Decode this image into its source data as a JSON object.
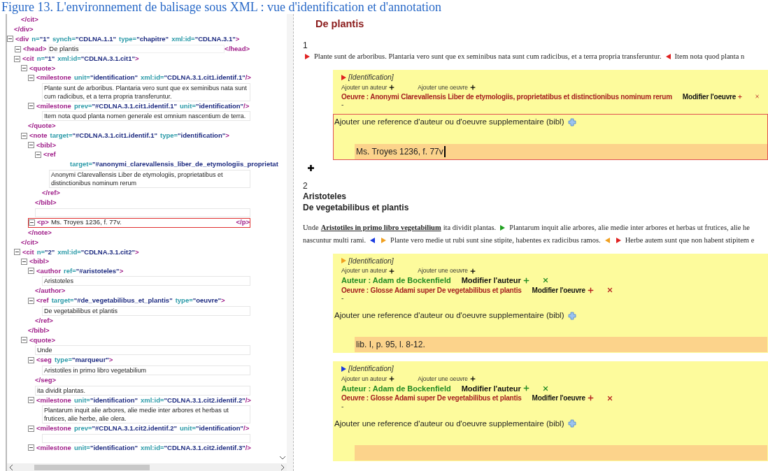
{
  "caption": "Figure 13. L'environnement de balisage sous XML : vue d'identification et d'annotation",
  "xml_tree": [
    {
      "kind": "fragment",
      "close": [
        {
          "kind": "tag",
          "text": "</div>"
        }
      ],
      "children": [
        {
          "kind": "fragment",
          "close": [
            {
              "kind": "tag",
              "text": "</cit>"
            }
          ]
        }
      ]
    },
    {
      "kind": "element",
      "expanded": true,
      "open": [
        {
          "kind": "tag",
          "text": "<div"
        },
        {
          "kind": "attr",
          "text": "n="
        },
        {
          "kind": "value",
          "text": "\"1\""
        },
        {
          "kind": "attr",
          "text": "synch="
        },
        {
          "kind": "value",
          "text": "\"CDLNA.1.1\""
        },
        {
          "kind": "attr",
          "text": "type="
        },
        {
          "kind": "value",
          "text": "\"chapitre\""
        },
        {
          "kind": "attr",
          "text": "xml:id="
        },
        {
          "kind": "value",
          "text": "\"CDLNA.3.1\""
        },
        {
          "kind": "tag",
          "text": ">"
        }
      ],
      "children": [
        {
          "kind": "inline",
          "expanded": true,
          "selected": false,
          "open": [
            {
              "kind": "tag",
              "text": "<head>"
            }
          ],
          "text": "De plantis",
          "close": [
            {
              "kind": "tag",
              "text": "</head>"
            }
          ]
        },
        {
          "kind": "element",
          "expanded": true,
          "open": [
            {
              "kind": "tag",
              "text": "<cit"
            },
            {
              "kind": "attr",
              "text": "n="
            },
            {
              "kind": "value",
              "text": "\"1\""
            },
            {
              "kind": "attr",
              "text": "xml:id="
            },
            {
              "kind": "value",
              "text": "\"CDLNA.3.1.cit1\""
            },
            {
              "kind": "tag",
              "text": ">"
            }
          ],
          "close": [
            {
              "kind": "tag",
              "text": "</cit>"
            }
          ],
          "children": [
            {
              "kind": "element",
              "expanded": true,
              "open": [
                {
                  "kind": "tag",
                  "text": "<quote>"
                }
              ],
              "close": [
                {
                  "kind": "tag",
                  "text": "</quote>"
                }
              ],
              "children": [
                {
                  "kind": "element",
                  "expanded": true,
                  "open": [
                    {
                      "kind": "tag",
                      "text": "<milestone"
                    },
                    {
                      "kind": "attr",
                      "text": "unit="
                    },
                    {
                      "kind": "value",
                      "text": "\"identification\""
                    },
                    {
                      "kind": "attr",
                      "text": "xml:id="
                    },
                    {
                      "kind": "value",
                      "text": "\"CDLNA.3.1.cit1.identif.1\""
                    },
                    {
                      "kind": "tag",
                      "text": "/>"
                    }
                  ],
                  "children": [
                    {
                      "kind": "text",
                      "text": "Plante sunt de arboribus. Plantaria vero sunt que ex seminibus nata sunt cum radicibus, et a terra propria transferuntur."
                    }
                  ]
                },
                {
                  "kind": "element",
                  "expanded": true,
                  "open": [
                    {
                      "kind": "tag",
                      "text": "<milestone"
                    },
                    {
                      "kind": "attr",
                      "text": "prev="
                    },
                    {
                      "kind": "value",
                      "text": "\"#CDLNA.3.1.cit1.identif.1\""
                    },
                    {
                      "kind": "attr",
                      "text": "unit="
                    },
                    {
                      "kind": "value",
                      "text": "\"identification\""
                    },
                    {
                      "kind": "tag",
                      "text": "/>"
                    }
                  ],
                  "children": [
                    {
                      "kind": "text",
                      "text": "Item nota quod planta nomen generale est omnium nascentium de terra."
                    }
                  ]
                }
              ]
            },
            {
              "kind": "element",
              "expanded": true,
              "open": [
                {
                  "kind": "tag",
                  "text": "<note"
                },
                {
                  "kind": "attr",
                  "text": "target="
                },
                {
                  "kind": "value",
                  "text": "\"#CDLNA.3.1.cit1.identif.1\""
                },
                {
                  "kind": "attr",
                  "text": "type="
                },
                {
                  "kind": "value",
                  "text": "\"identification\""
                },
                {
                  "kind": "tag",
                  "text": ">"
                }
              ],
              "close": [
                {
                  "kind": "tag",
                  "text": "</note>"
                }
              ],
              "children": [
                {
                  "kind": "element",
                  "expanded": true,
                  "open": [
                    {
                      "kind": "tag",
                      "text": "<bibl>"
                    }
                  ],
                  "close": [
                    {
                      "kind": "tag",
                      "text": "</bibl>"
                    }
                  ],
                  "children": [
                    {
                      "kind": "element",
                      "expanded": true,
                      "open": [
                        {
                          "kind": "tag",
                          "text": "<ref"
                        }
                      ],
                      "open_continued": [
                        {
                          "kind": "attr",
                          "text": "target="
                        },
                        {
                          "kind": "value",
                          "text": "\"#anonymi_clarevallensis_liber_de_etymologiis_proprietat"
                        }
                      ],
                      "close": [
                        {
                          "kind": "tag",
                          "text": "</ref>"
                        }
                      ],
                      "children": [
                        {
                          "kind": "text",
                          "text": "Anonymi Clarevallensis Liber de etymologiis, proprietatibus et distinctionibus nominum rerum"
                        }
                      ]
                    }
                  ]
                },
                {
                  "kind": "empty_field"
                },
                {
                  "kind": "inline",
                  "expanded": true,
                  "selected": true,
                  "open": [
                    {
                      "kind": "tag",
                      "text": "<p>"
                    }
                  ],
                  "text": "Ms. Troyes 1236, f. 77v.",
                  "close": [
                    {
                      "kind": "tag",
                      "text": "</p>"
                    }
                  ]
                }
              ]
            }
          ]
        },
        {
          "kind": "element",
          "expanded": true,
          "open": [
            {
              "kind": "tag",
              "text": "<cit"
            },
            {
              "kind": "attr",
              "text": "n="
            },
            {
              "kind": "value",
              "text": "\"2\""
            },
            {
              "kind": "attr",
              "text": "xml:id="
            },
            {
              "kind": "value",
              "text": "\"CDLNA.3.1.cit2\""
            },
            {
              "kind": "tag",
              "text": ">"
            }
          ],
          "children": [
            {
              "kind": "element",
              "expanded": true,
              "open": [
                {
                  "kind": "tag",
                  "text": "<bibl>"
                }
              ],
              "close": [
                {
                  "kind": "tag",
                  "text": "</bibl>"
                }
              ],
              "children": [
                {
                  "kind": "element",
                  "expanded": true,
                  "open": [
                    {
                      "kind": "tag",
                      "text": "<author"
                    },
                    {
                      "kind": "attr",
                      "text": "ref="
                    },
                    {
                      "kind": "value",
                      "text": "\"#aristoteles\""
                    },
                    {
                      "kind": "tag",
                      "text": ">"
                    }
                  ],
                  "close": [
                    {
                      "kind": "tag",
                      "text": "</author>"
                    }
                  ],
                  "children": [
                    {
                      "kind": "text",
                      "text": "Aristoteles"
                    }
                  ]
                },
                {
                  "kind": "element",
                  "expanded": true,
                  "open": [
                    {
                      "kind": "tag",
                      "text": "<ref"
                    },
                    {
                      "kind": "attr",
                      "text": "target="
                    },
                    {
                      "kind": "value",
                      "text": "\"#de_vegetabilibus_et_plantis\""
                    },
                    {
                      "kind": "attr",
                      "text": "type="
                    },
                    {
                      "kind": "value",
                      "text": "\"oeuvre\""
                    },
                    {
                      "kind": "tag",
                      "text": ">"
                    }
                  ],
                  "close": [
                    {
                      "kind": "tag",
                      "text": "</ref>"
                    }
                  ],
                  "children": [
                    {
                      "kind": "text",
                      "text": "De vegetabilibus et plantis"
                    }
                  ]
                }
              ]
            },
            {
              "kind": "element",
              "expanded": true,
              "open": [
                {
                  "kind": "tag",
                  "text": "<quote>"
                }
              ],
              "children": [
                {
                  "kind": "text",
                  "text": "Unde"
                },
                {
                  "kind": "element",
                  "expanded": true,
                  "open": [
                    {
                      "kind": "tag",
                      "text": "<seg"
                    },
                    {
                      "kind": "attr",
                      "text": "type="
                    },
                    {
                      "kind": "value",
                      "text": "\"marqueur\""
                    },
                    {
                      "kind": "tag",
                      "text": ">"
                    }
                  ],
                  "close": [
                    {
                      "kind": "tag",
                      "text": "</seg>"
                    }
                  ],
                  "children": [
                    {
                      "kind": "text",
                      "text": "Aristotiles in primo libro vegetabilium"
                    }
                  ]
                },
                {
                  "kind": "text",
                  "text": "ita dividit plantas."
                },
                {
                  "kind": "element",
                  "expanded": true,
                  "open": [
                    {
                      "kind": "tag",
                      "text": "<milestone"
                    },
                    {
                      "kind": "attr",
                      "text": "unit="
                    },
                    {
                      "kind": "value",
                      "text": "\"identification\""
                    },
                    {
                      "kind": "attr",
                      "text": "xml:id="
                    },
                    {
                      "kind": "value",
                      "text": "\"CDLNA.3.1.cit2.identif.2\""
                    },
                    {
                      "kind": "tag",
                      "text": "/>"
                    }
                  ],
                  "children": [
                    {
                      "kind": "text",
                      "text": "Plantarum inquit alie arbores, alie medie inter arbores et herbas ut frutices, alie herbe, alie olera."
                    }
                  ]
                },
                {
                  "kind": "element",
                  "expanded": true,
                  "open": [
                    {
                      "kind": "tag",
                      "text": "<milestone"
                    },
                    {
                      "kind": "attr",
                      "text": "prev="
                    },
                    {
                      "kind": "value",
                      "text": "\"#CDLNA.3.1.cit2.identif.2\""
                    },
                    {
                      "kind": "attr",
                      "text": "unit="
                    },
                    {
                      "kind": "value",
                      "text": "\"identification\""
                    },
                    {
                      "kind": "tag",
                      "text": "/>"
                    }
                  ],
                  "children": [
                    {
                      "kind": "empty_field"
                    }
                  ]
                },
                {
                  "kind": "element",
                  "expanded": true,
                  "open": [
                    {
                      "kind": "tag",
                      "text": "<milestone"
                    },
                    {
                      "kind": "attr",
                      "text": "unit="
                    },
                    {
                      "kind": "value",
                      "text": "\"identification\""
                    },
                    {
                      "kind": "attr",
                      "text": "xml:id="
                    },
                    {
                      "kind": "value",
                      "text": "\"CDLNA.3.1.cit2.identif.3\""
                    },
                    {
                      "kind": "tag",
                      "text": "/>"
                    }
                  ]
                }
              ]
            }
          ]
        }
      ]
    }
  ],
  "document": {
    "title": "De plantis",
    "sections": [
      {
        "number": "1",
        "add_annotation": true,
        "lines": [
          [
            {
              "kind": "start_marker",
              "color": "#e02020"
            },
            {
              "kind": "text",
              "text": "Plante sunt de arboribus. Plantaria vero sunt que ex seminibus nata sunt cum radicibus, et a terra propria transferuntur."
            },
            {
              "kind": "end_marker",
              "color": "#e02020"
            },
            {
              "kind": "text",
              "text": "Item nota quod planta n"
            }
          ]
        ],
        "annotations": [
          {
            "color": "#e02020",
            "label": "[Identification]",
            "add_author": "Ajouter un auteur",
            "add_work": "Ajouter une oeuvre",
            "work": {
              "text": "Oeuvre : Anonymi Clarevallensis Liber de etymologiis, proprietatibus et distinctionibus nominum rerum",
              "edit": "Modifier l'oeuvre"
            },
            "dash": "-",
            "add_ref": "Ajouter une reference d'auteur ou d'oeuvre supplementaire (bibl)",
            "ref": {
              "value": "Ms. Troyes 1236, f. 77v",
              "focused": true
            }
          }
        ]
      },
      {
        "number": "2",
        "headings": [
          "Aristoteles",
          "De vegetabilibus et plantis"
        ],
        "lines": [
          [
            {
              "kind": "text",
              "text": "Unde"
            },
            {
              "kind": "emphasis",
              "text": "Aristotiles in primo libro vegetabilium"
            },
            {
              "kind": "text",
              "text": "ita dividit plantas."
            },
            {
              "kind": "start_marker",
              "color": "#20a020"
            },
            {
              "kind": "text",
              "text": "Plantarum inquit alie arbores, alie medie inter arbores et herbas ut frutices, alie he"
            }
          ],
          [
            {
              "kind": "text",
              "text": "nascuntur multi rami."
            },
            {
              "kind": "end_marker",
              "color": "#1a3ae0"
            },
            {
              "kind": "start_marker",
              "color": "#f0a020"
            },
            {
              "kind": "text",
              "text": "Plante vero medie ut rubi sunt sine stipite, habentes ex radicibus ramos."
            },
            {
              "kind": "end_marker",
              "color": "#f0a020"
            },
            {
              "kind": "start_marker",
              "color": "#e02020"
            },
            {
              "kind": "text",
              "text": "Herbe autem sunt que non habent stipitem e"
            }
          ]
        ],
        "annotations": [
          {
            "color": "#f0a020",
            "label": "[Identification]",
            "add_author": "Ajouter un auteur",
            "add_work": "Ajouter une oeuvre",
            "author": {
              "text": "Auteur : Adam de Bockenfield",
              "edit": "Modifier l'auteur"
            },
            "work": {
              "text": "Oeuvre : Glosse Adami super De vegetabilibus et plantis",
              "edit": "Modifier l'oeuvre"
            },
            "dash": "-",
            "add_ref": "Ajouter une reference d'auteur ou d'oeuvre supplementaire (bibl)",
            "ref": {
              "value": "lib. I, p. 95, l. 8-12.",
              "focused": false
            }
          },
          {
            "color": "#1a3ae0",
            "label": "[Identification]",
            "add_author": "Ajouter un auteur",
            "add_work": "Ajouter une oeuvre",
            "author": {
              "text": "Auteur : Adam de Bockenfield",
              "edit": "Modifier l'auteur"
            },
            "work": {
              "text": "Oeuvre : Glosse Adami super De vegetabilibus et plantis",
              "edit": "Modifier l'oeuvre"
            },
            "dash": "-",
            "add_ref": "Ajouter une reference d'auteur ou d'oeuvre supplementaire (bibl)",
            "ref": {
              "focused": false
            }
          }
        ]
      }
    ]
  }
}
